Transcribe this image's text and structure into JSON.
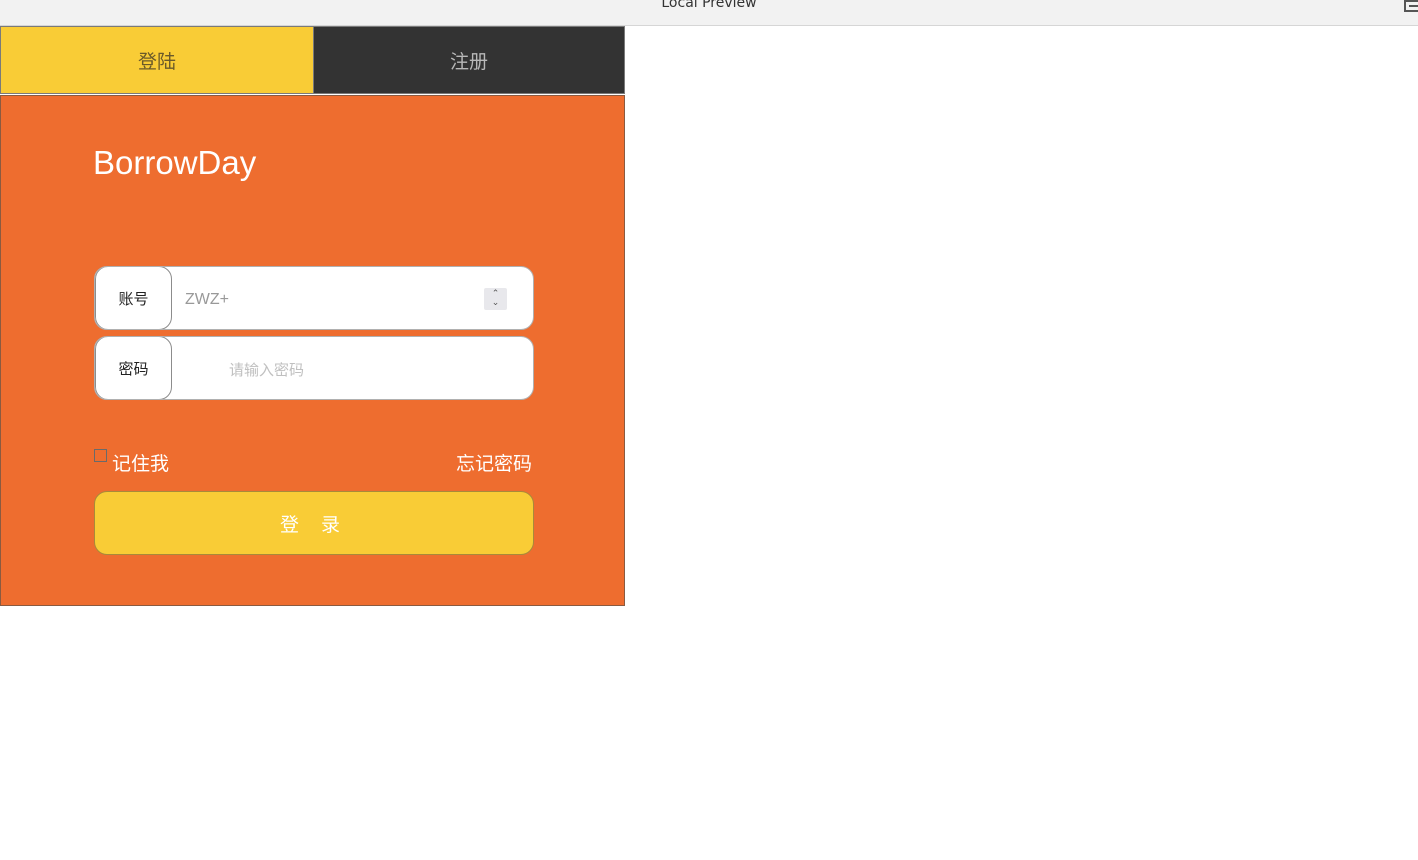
{
  "window": {
    "title": "Local Preview"
  },
  "tabs": [
    {
      "label": "登陆",
      "active": true
    },
    {
      "label": "注册",
      "active": false
    }
  ],
  "brand": {
    "name": "BorrowDay"
  },
  "form": {
    "account_label": "账号",
    "account_value": "ZWZ+",
    "password_label": "密码",
    "password_placeholder": "请输入密码",
    "remember_label": "记住我",
    "remember_checked": false,
    "forgot_label": "忘记密码",
    "submit_label": "登 录"
  },
  "colors": {
    "active_tab": "#f9cc36",
    "inactive_tab": "#333333",
    "form_background": "#ee6d2f",
    "button": "#f9cc36"
  },
  "icons": {
    "spinner": "number-spinner-icon",
    "menu": "menu-icon"
  }
}
